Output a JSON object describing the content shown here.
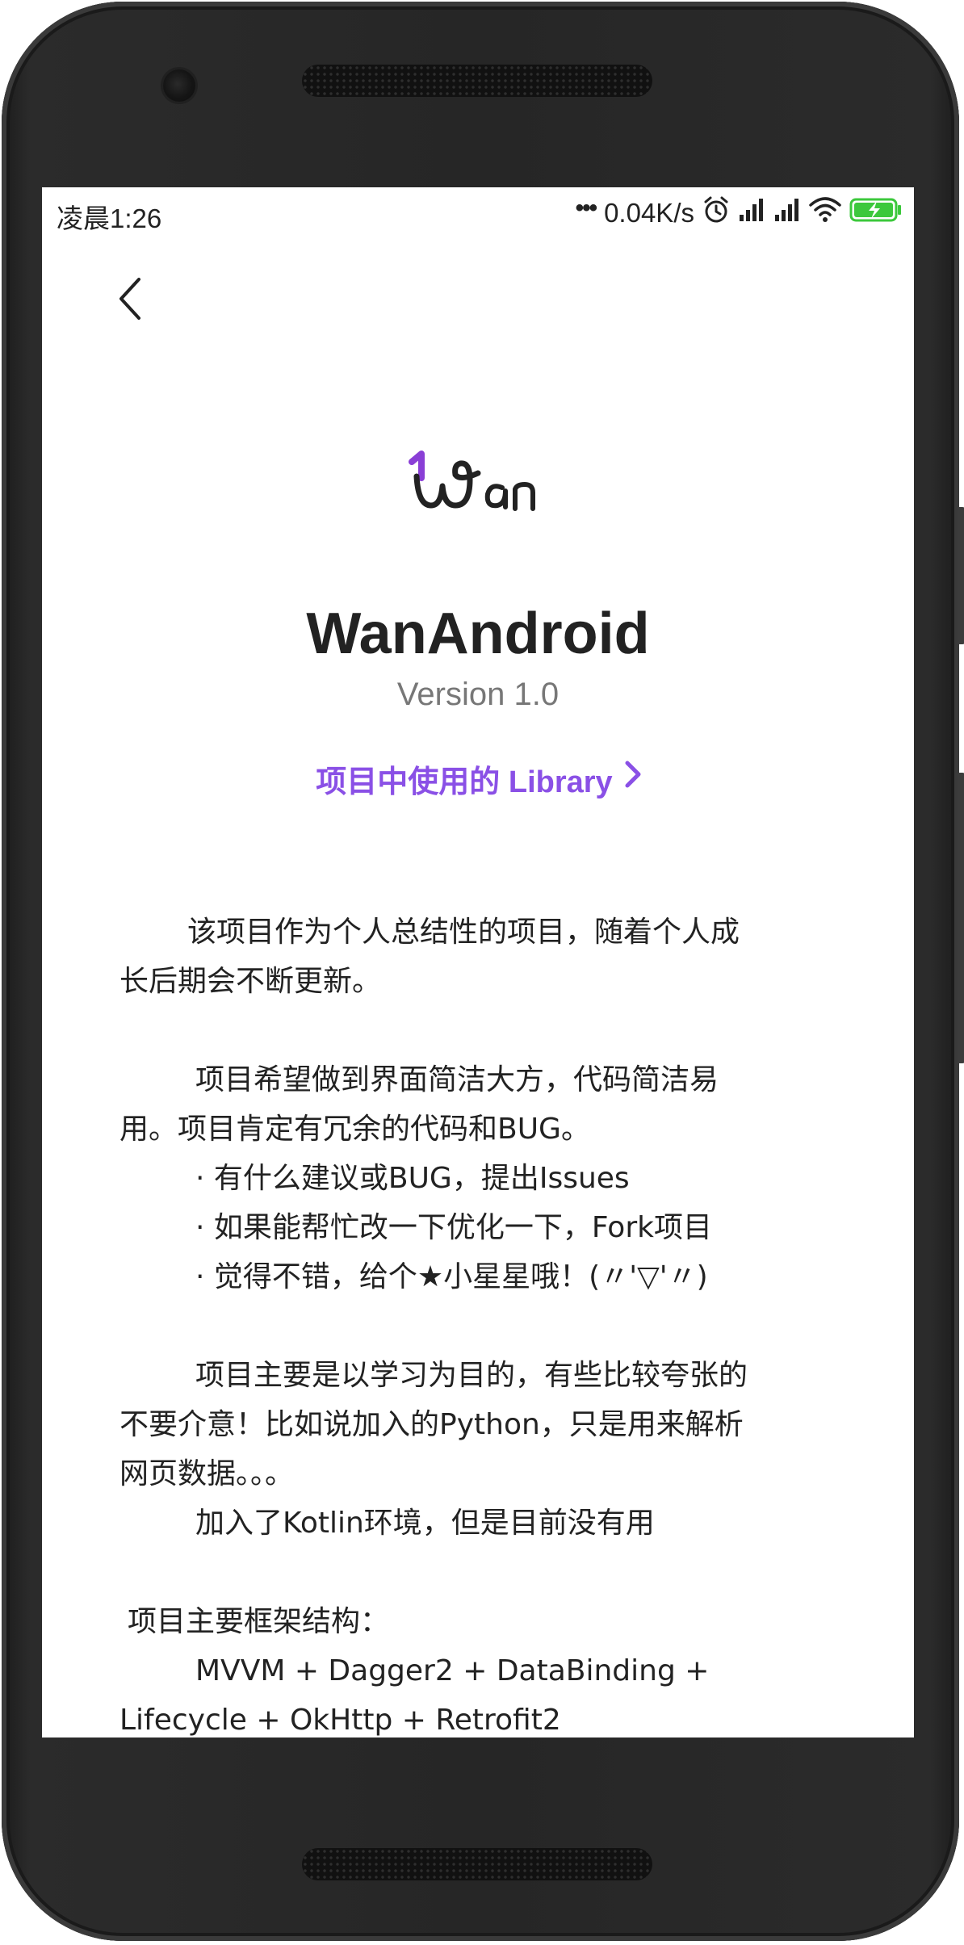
{
  "status_bar": {
    "time": "凌晨1:26",
    "network_speed": "0.04K/s",
    "icons": [
      "more-dots-icon",
      "alarm-icon",
      "signal-icon",
      "signal-icon",
      "wifi-icon",
      "battery-charging-icon"
    ],
    "battery_color": "#3cc83c"
  },
  "nav": {
    "back_icon": "chevron-left-icon"
  },
  "about": {
    "logo_text": "wan",
    "logo_accent_color": "#8a3fd6",
    "app_name": "WanAndroid",
    "version": "Version 1.0",
    "library_link_label": "项目中使用的 Library",
    "library_link_color": "#8a50e6"
  },
  "description": {
    "para1_line1": "该项目作为个人总结性的项目，随着个人成",
    "para1_line2": "长后期会不断更新。",
    "para2_line1": "项目希望做到界面简洁大方，代码简洁易",
    "para2_line2": "用。项目肯定有冗余的代码和BUG。",
    "bullet1": "· 有什么建议或BUG，提出Issues",
    "bullet2": "· 如果能帮忙改一下优化一下，Fork项目",
    "bullet3": "· 觉得不错，给个★小星星哦！(〃'▽'〃)",
    "para3_line1": "项目主要是以学习为目的，有些比较夸张的",
    "para3_line2": "不要介意！比如说加入的Python，只是用来解析",
    "para3_line3": "网页数据。。。",
    "para3_line4": "加入了Kotlin环境，但是目前没有用",
    "framework_title": "项目主要框架结构：",
    "framework_line1": "MVVM + Dagger2 + DataBinding +",
    "framework_line2": "Lifecycle + OkHttp + Retrofit2"
  }
}
